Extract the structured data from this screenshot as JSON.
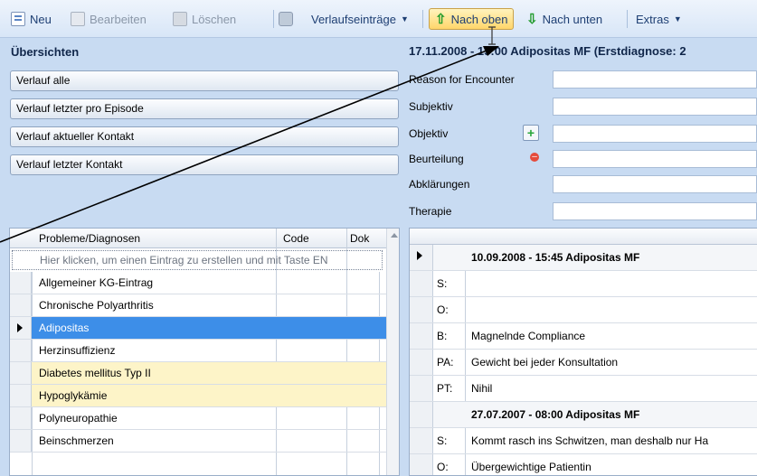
{
  "toolbar": {
    "new_label": "Neu",
    "edit_label": "Bearbeiten",
    "delete_label": "Löschen",
    "history_label": "Verlaufseinträge",
    "up_label": "Nach oben",
    "down_label": "Nach unten",
    "extras_label": "Extras"
  },
  "overview": {
    "title": "Übersichten",
    "buttons": [
      "Verlauf alle",
      "Verlauf letzter pro Episode",
      "Verlauf aktueller Kontakt",
      "Verlauf letzter Kontakt"
    ]
  },
  "record": {
    "title": "17.11.2008 - 15:00 Adipositas  MF (Erstdiagnose: 2",
    "fields": [
      "Reason for Encounter",
      "Subjektiv",
      "Objektiv",
      "Beurteilung",
      "Abklärungen",
      "Therapie"
    ]
  },
  "problems": {
    "headers": [
      "Probleme/Diagnosen",
      "Code",
      "Dok"
    ],
    "new_row_hint": "Hier klicken, um einen Eintrag zu erstellen und mit Taste EN",
    "rows": [
      {
        "label": "Allgemeiner KG-Eintrag",
        "state": "normal"
      },
      {
        "label": "Chronische Polyarthritis",
        "state": "normal"
      },
      {
        "label": "Adipositas",
        "state": "selected"
      },
      {
        "label": "Herzinsuffizienz",
        "state": "normal"
      },
      {
        "label": "Diabetes mellitus Typ II",
        "state": "highlight"
      },
      {
        "label": "Hypoglykämie",
        "state": "highlight"
      },
      {
        "label": "Polyneuropathie",
        "state": "normal"
      },
      {
        "label": "Beinschmerzen",
        "state": "normal"
      }
    ]
  },
  "history": {
    "rows": [
      {
        "type": "group",
        "label": "10.09.2008 - 15:45 Adipositas MF"
      },
      {
        "type": "entry",
        "code": "S:",
        "text": ""
      },
      {
        "type": "entry",
        "code": "O:",
        "text": ""
      },
      {
        "type": "entry",
        "code": "B:",
        "text": "Magnelnde Compliance"
      },
      {
        "type": "entry",
        "code": "PA:",
        "text": "Gewicht bei jeder Konsultation"
      },
      {
        "type": "entry",
        "code": "PT:",
        "text": "Nihil"
      },
      {
        "type": "group",
        "label": "27.07.2007 - 08:00 Adipositas MF"
      },
      {
        "type": "entry",
        "code": "S:",
        "text": "Kommt rasch ins Schwitzen, man deshalb nur Ha"
      },
      {
        "type": "entry",
        "code": "O:",
        "text": "Übergewichtige Patientin"
      }
    ]
  }
}
